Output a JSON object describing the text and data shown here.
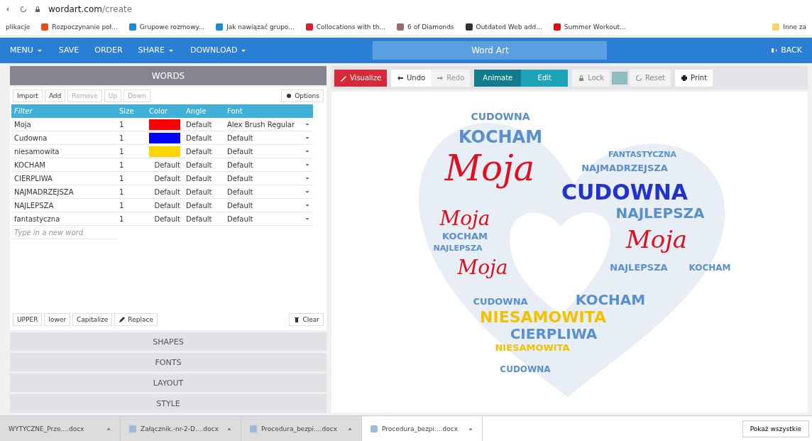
{
  "browser": {
    "url_host": "wordart.com",
    "url_path": "/create",
    "bookmarks": [
      {
        "label": "plikacje"
      },
      {
        "label": "Rozpoczynanie poł...",
        "color": "#e8501a"
      },
      {
        "label": "Grupowe rozmowy...",
        "color": "#1e88d8"
      },
      {
        "label": "Jak nawiązać grupo...",
        "color": "#1e88d8"
      },
      {
        "label": "Collocations with th...",
        "color": "#d8202a"
      },
      {
        "label": "6 of Diamonds",
        "color": "#9a6a6a"
      },
      {
        "label": "Outdated Web add...",
        "color": "#333333"
      },
      {
        "label": "Summer Workout...",
        "color": "#e01010"
      }
    ],
    "other_bookmarks": "Inne za"
  },
  "nav": {
    "items": [
      {
        "label": "MENU",
        "caret": true
      },
      {
        "label": "SAVE",
        "caret": false
      },
      {
        "label": "ORDER",
        "caret": false
      },
      {
        "label": "SHARE",
        "caret": true
      },
      {
        "label": "DOWNLOAD",
        "caret": true
      }
    ],
    "title": "Word Art",
    "back": "BACK"
  },
  "words_panel": {
    "title": "WORDS",
    "toolbar": [
      {
        "label": "Import",
        "disabled": false
      },
      {
        "label": "Add",
        "disabled": false
      },
      {
        "label": "Remove",
        "disabled": true
      },
      {
        "label": "Up",
        "disabled": true
      },
      {
        "label": "Down",
        "disabled": true
      }
    ],
    "options": "Options",
    "columns": [
      "Filter",
      "Size",
      "Color",
      "Angle",
      "Font"
    ],
    "rows": [
      {
        "word": "Moja",
        "size": "1",
        "color": "#ff0000",
        "angle": "Default",
        "font": "Alex Brush Regular"
      },
      {
        "word": "Cudowna",
        "size": "1",
        "color": "#0000ff",
        "angle": "Default",
        "font": "Default"
      },
      {
        "word": "niesamowita",
        "size": "1",
        "color": "#ffd500",
        "angle": "Default",
        "font": "Default"
      },
      {
        "word": "KOCHAM",
        "size": "1",
        "color_label": "Default",
        "angle": "Default",
        "font": "Default"
      },
      {
        "word": "CIERPLIWA",
        "size": "1",
        "color_label": "Default",
        "angle": "Default",
        "font": "Default"
      },
      {
        "word": "NAJMADRZEJSZA",
        "size": "1",
        "color_label": "Default",
        "angle": "Default",
        "font": "Default"
      },
      {
        "word": "NAJLEPSZA",
        "size": "1",
        "color_label": "Default",
        "angle": "Default",
        "font": "Default"
      },
      {
        "word": "fantastyczna",
        "size": "1",
        "color_label": "Default",
        "angle": "Default",
        "font": "Default"
      }
    ],
    "new_word_placeholder": "Type in a new word",
    "case_buttons": [
      "UPPER",
      "lower",
      "Capitalize"
    ],
    "replace": "Replace",
    "clear": "Clear"
  },
  "sections": [
    "SHAPES",
    "FONTS",
    "LAYOUT",
    "STYLE"
  ],
  "canvas_toolbar": {
    "visualize": "Visualize",
    "undo": {
      "label": "Undo",
      "disabled": false
    },
    "redo": {
      "label": "Redo",
      "disabled": true
    },
    "modes": [
      {
        "label": "Animate",
        "selected": true
      },
      {
        "label": "Edit",
        "selected": false
      }
    ],
    "lock": "Lock",
    "reset": "Reset",
    "print": "Print"
  },
  "cloud_words": [
    {
      "text": "CUDOWNA",
      "color": "#5a8fcf"
    },
    {
      "text": "KOCHAM",
      "color": "#5a8fcf"
    },
    {
      "text": "Moja",
      "color": "#e0101e"
    },
    {
      "text": "FANTASTYCZNA",
      "color": "#5a8fcf"
    },
    {
      "text": "NAJMADRZEJSZA",
      "color": "#5a8fcf"
    },
    {
      "text": "CUDOWNA",
      "color": "#2233cc"
    },
    {
      "text": "NAJLEPSZA",
      "color": "#5a8fcf"
    },
    {
      "text": "Moja",
      "color": "#e0101e"
    },
    {
      "text": "KOCHAM",
      "color": "#5a8fcf"
    },
    {
      "text": "NAJLEPSZA",
      "color": "#5a8fcf"
    },
    {
      "text": "Moja",
      "color": "#e0101e"
    },
    {
      "text": "Moja",
      "color": "#e0101e"
    },
    {
      "text": "NAJLEPSZA",
      "color": "#5a8fcf"
    },
    {
      "text": "KOCHAM",
      "color": "#5a8fcf"
    },
    {
      "text": "CUDOWNA",
      "color": "#5a8fcf"
    },
    {
      "text": "KOCHAM",
      "color": "#5a8fcf"
    },
    {
      "text": "NIESAMOWITA",
      "color": "#f2c200"
    },
    {
      "text": "CIERPLIWA",
      "color": "#5a8fcf"
    },
    {
      "text": "NIESAMOWITA",
      "color": "#f2c200"
    },
    {
      "text": "CUDOWNA",
      "color": "#5a8fcf"
    }
  ],
  "downloads": [
    {
      "name": "WYTYCZNE_Prze....docx",
      "selected": false,
      "icon": false
    },
    {
      "name": "Załącznik.-nr-2-D....docx",
      "selected": false,
      "icon": true
    },
    {
      "name": "Procedura_bezpi....docx",
      "selected": false,
      "icon": true
    },
    {
      "name": "Procedura_bezpi....docx",
      "selected": true,
      "icon": true
    }
  ],
  "show_all": "Pokaż wszystkie"
}
